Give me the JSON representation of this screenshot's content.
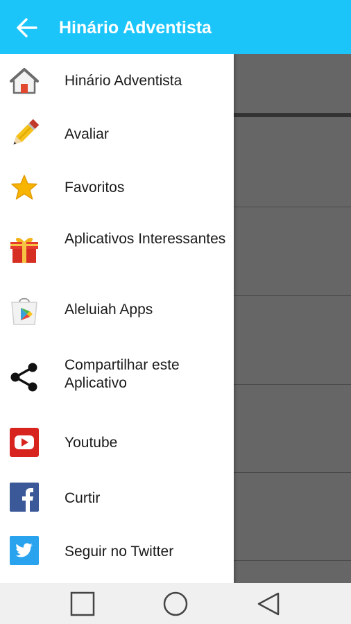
{
  "appbar": {
    "title": "Hinário Adventista",
    "back_icon": "arrow-left-icon",
    "color": "#1cc5f9"
  },
  "drawer": {
    "items": [
      {
        "label": "Hinário Adventista",
        "icon": "home-icon"
      },
      {
        "label": "Avaliar",
        "icon": "pencil-icon"
      },
      {
        "label": "Favoritos",
        "icon": "star-icon"
      },
      {
        "label": "Aplicativos Interessantes",
        "icon": "gift-icon"
      },
      {
        "label": "Aleluiah Apps",
        "icon": "play-store-icon"
      },
      {
        "label": "Compartilhar este Aplicativo",
        "icon": "share-icon"
      },
      {
        "label": "Youtube",
        "icon": "youtube-icon"
      },
      {
        "label": "Curtir",
        "icon": "facebook-icon"
      },
      {
        "label": "Seguir no Twitter",
        "icon": "twitter-icon"
      }
    ]
  },
  "navbar": {
    "buttons": [
      "recents-icon",
      "home-circle-icon",
      "back-triangle-icon"
    ]
  }
}
